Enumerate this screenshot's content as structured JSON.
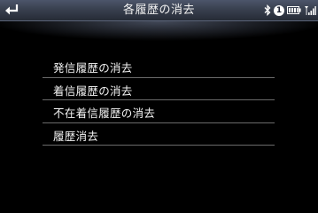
{
  "header": {
    "title": "各履歴の消去",
    "back_icon": "back-arrow-icon",
    "status": {
      "bluetooth_icon": "bluetooth-icon",
      "bluetooth_device_number": "1",
      "battery_icon": "battery-icon",
      "signal_icon": "signal-strength-icon"
    }
  },
  "menu": {
    "items": [
      {
        "label": "発信履歴の消去"
      },
      {
        "label": "着信履歴の消去"
      },
      {
        "label": "不在着信履歴の消去"
      },
      {
        "label": "履歴消去"
      }
    ]
  }
}
